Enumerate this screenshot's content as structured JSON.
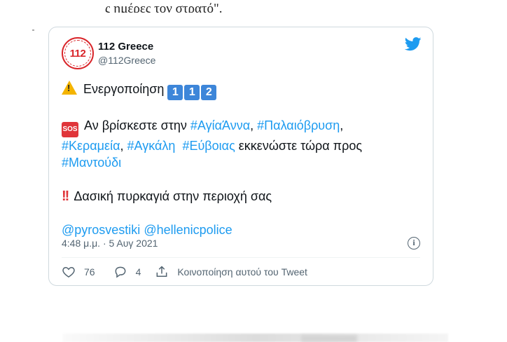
{
  "background": {
    "top_snippet": "ς ημέρες τον στρατό\"."
  },
  "tweet": {
    "author": {
      "name": "112 Greece",
      "handle": "@112Greece",
      "avatar_text": "112",
      "avatar_color": "#d9252a"
    },
    "brand_icon": "twitter-bird-icon",
    "brand_color": "#1d9bf0",
    "line1": {
      "emoji": "warning-emoji",
      "text": "Ενεργοποίηση",
      "keycaps": [
        "1",
        "1",
        "2"
      ]
    },
    "line2": {
      "emoji": "sos-emoji",
      "emoji_text": "SOS",
      "text_before": "Αν βρίσκεστε στην",
      "hashtag1": "#ΑγίαΆννα",
      "sep1": ",",
      "hashtag2": "#Παλαιόβρυση",
      "sep2": ","
    },
    "line3": {
      "hashtag3": "#Κεραμεία",
      "sep3": ",",
      "hashtag4": "#Αγκάλη",
      "hashtag5": "#Εύβοιας",
      "text_after": "εκκενώστε τώρα προς"
    },
    "line4": {
      "hashtag6": "#Μαντούδι"
    },
    "line5": {
      "emoji": "double-exclamation-emoji",
      "text": "Δασική πυρκαγιά στην περιοχή σας"
    },
    "mentions": [
      "@pyrosvestiki",
      "@hellenicpolice"
    ],
    "timestamp": "4:48 μ.μ. · 5 Αυγ 2021",
    "info_glyph": "i",
    "actions": {
      "likes": "76",
      "replies": "4",
      "share_label": "Κοινοποίηση αυτού του Tweet"
    },
    "link_color": "#1d9bf0",
    "muted_color": "#536471"
  }
}
